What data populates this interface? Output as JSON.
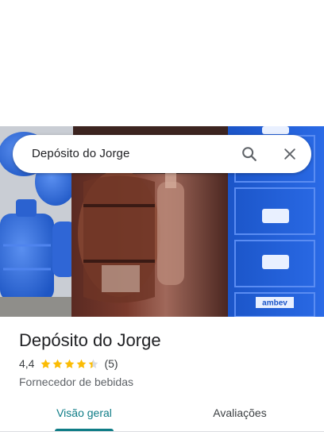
{
  "search": {
    "query": "Depósito do Jorge",
    "search_icon": "search-icon",
    "close_icon": "close-icon"
  },
  "place": {
    "name": "Depósito do Jorge",
    "rating_text": "4,4",
    "rating_value": 4.4,
    "rating_max": 5,
    "review_count": "(5)",
    "category": "Fornecedor de bebidas",
    "photo": "storefront-photo"
  },
  "tabs": [
    {
      "label": "Visão geral",
      "selected": true
    },
    {
      "label": "Avaliações",
      "selected": false
    }
  ],
  "colors": {
    "accent": "#0e7c86",
    "star": "#fbbc04",
    "crate_blue": "#1f5fd6"
  },
  "brand_marks": [
    "ambev"
  ]
}
